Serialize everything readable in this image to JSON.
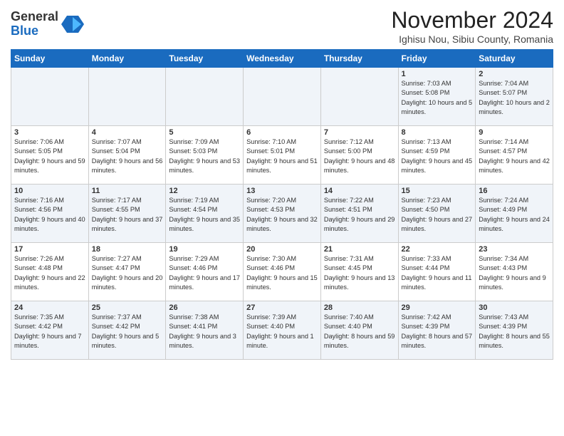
{
  "header": {
    "logo_general": "General",
    "logo_blue": "Blue",
    "month_title": "November 2024",
    "location": "Ighisu Nou, Sibiu County, Romania"
  },
  "days_of_week": [
    "Sunday",
    "Monday",
    "Tuesday",
    "Wednesday",
    "Thursday",
    "Friday",
    "Saturday"
  ],
  "weeks": [
    [
      {
        "day": "",
        "info": ""
      },
      {
        "day": "",
        "info": ""
      },
      {
        "day": "",
        "info": ""
      },
      {
        "day": "",
        "info": ""
      },
      {
        "day": "",
        "info": ""
      },
      {
        "day": "1",
        "info": "Sunrise: 7:03 AM\nSunset: 5:08 PM\nDaylight: 10 hours\nand 5 minutes."
      },
      {
        "day": "2",
        "info": "Sunrise: 7:04 AM\nSunset: 5:07 PM\nDaylight: 10 hours\nand 2 minutes."
      }
    ],
    [
      {
        "day": "3",
        "info": "Sunrise: 7:06 AM\nSunset: 5:05 PM\nDaylight: 9 hours\nand 59 minutes."
      },
      {
        "day": "4",
        "info": "Sunrise: 7:07 AM\nSunset: 5:04 PM\nDaylight: 9 hours\nand 56 minutes."
      },
      {
        "day": "5",
        "info": "Sunrise: 7:09 AM\nSunset: 5:03 PM\nDaylight: 9 hours\nand 53 minutes."
      },
      {
        "day": "6",
        "info": "Sunrise: 7:10 AM\nSunset: 5:01 PM\nDaylight: 9 hours\nand 51 minutes."
      },
      {
        "day": "7",
        "info": "Sunrise: 7:12 AM\nSunset: 5:00 PM\nDaylight: 9 hours\nand 48 minutes."
      },
      {
        "day": "8",
        "info": "Sunrise: 7:13 AM\nSunset: 4:59 PM\nDaylight: 9 hours\nand 45 minutes."
      },
      {
        "day": "9",
        "info": "Sunrise: 7:14 AM\nSunset: 4:57 PM\nDaylight: 9 hours\nand 42 minutes."
      }
    ],
    [
      {
        "day": "10",
        "info": "Sunrise: 7:16 AM\nSunset: 4:56 PM\nDaylight: 9 hours\nand 40 minutes."
      },
      {
        "day": "11",
        "info": "Sunrise: 7:17 AM\nSunset: 4:55 PM\nDaylight: 9 hours\nand 37 minutes."
      },
      {
        "day": "12",
        "info": "Sunrise: 7:19 AM\nSunset: 4:54 PM\nDaylight: 9 hours\nand 35 minutes."
      },
      {
        "day": "13",
        "info": "Sunrise: 7:20 AM\nSunset: 4:53 PM\nDaylight: 9 hours\nand 32 minutes."
      },
      {
        "day": "14",
        "info": "Sunrise: 7:22 AM\nSunset: 4:51 PM\nDaylight: 9 hours\nand 29 minutes."
      },
      {
        "day": "15",
        "info": "Sunrise: 7:23 AM\nSunset: 4:50 PM\nDaylight: 9 hours\nand 27 minutes."
      },
      {
        "day": "16",
        "info": "Sunrise: 7:24 AM\nSunset: 4:49 PM\nDaylight: 9 hours\nand 24 minutes."
      }
    ],
    [
      {
        "day": "17",
        "info": "Sunrise: 7:26 AM\nSunset: 4:48 PM\nDaylight: 9 hours\nand 22 minutes."
      },
      {
        "day": "18",
        "info": "Sunrise: 7:27 AM\nSunset: 4:47 PM\nDaylight: 9 hours\nand 20 minutes."
      },
      {
        "day": "19",
        "info": "Sunrise: 7:29 AM\nSunset: 4:46 PM\nDaylight: 9 hours\nand 17 minutes."
      },
      {
        "day": "20",
        "info": "Sunrise: 7:30 AM\nSunset: 4:46 PM\nDaylight: 9 hours\nand 15 minutes."
      },
      {
        "day": "21",
        "info": "Sunrise: 7:31 AM\nSunset: 4:45 PM\nDaylight: 9 hours\nand 13 minutes."
      },
      {
        "day": "22",
        "info": "Sunrise: 7:33 AM\nSunset: 4:44 PM\nDaylight: 9 hours\nand 11 minutes."
      },
      {
        "day": "23",
        "info": "Sunrise: 7:34 AM\nSunset: 4:43 PM\nDaylight: 9 hours\nand 9 minutes."
      }
    ],
    [
      {
        "day": "24",
        "info": "Sunrise: 7:35 AM\nSunset: 4:42 PM\nDaylight: 9 hours\nand 7 minutes."
      },
      {
        "day": "25",
        "info": "Sunrise: 7:37 AM\nSunset: 4:42 PM\nDaylight: 9 hours\nand 5 minutes."
      },
      {
        "day": "26",
        "info": "Sunrise: 7:38 AM\nSunset: 4:41 PM\nDaylight: 9 hours\nand 3 minutes."
      },
      {
        "day": "27",
        "info": "Sunrise: 7:39 AM\nSunset: 4:40 PM\nDaylight: 9 hours\nand 1 minute."
      },
      {
        "day": "28",
        "info": "Sunrise: 7:40 AM\nSunset: 4:40 PM\nDaylight: 8 hours\nand 59 minutes."
      },
      {
        "day": "29",
        "info": "Sunrise: 7:42 AM\nSunset: 4:39 PM\nDaylight: 8 hours\nand 57 minutes."
      },
      {
        "day": "30",
        "info": "Sunrise: 7:43 AM\nSunset: 4:39 PM\nDaylight: 8 hours\nand 55 minutes."
      }
    ]
  ]
}
